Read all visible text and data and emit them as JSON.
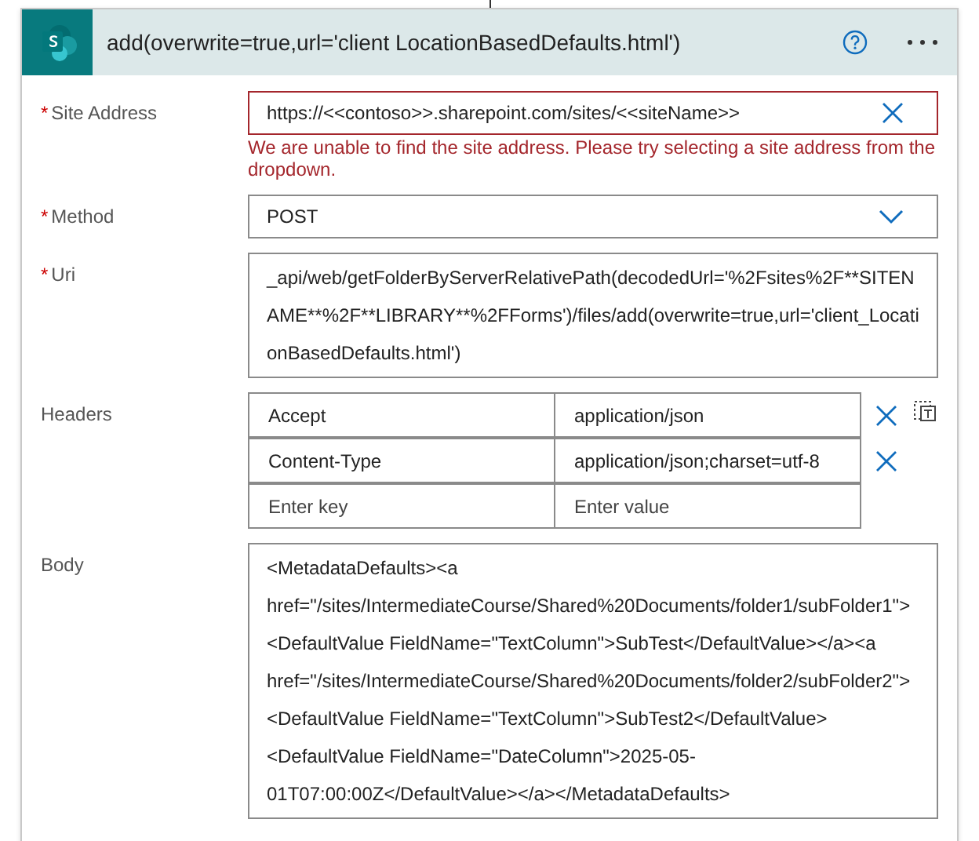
{
  "card": {
    "title": "add(overwrite=true,url='client LocationBasedDefaults.html')",
    "fields": [
      {
        "kind": "text",
        "label": "Site Address",
        "marker": "*",
        "value": "https://<<contoso>>.sharepoint.com/sites/<<siteName>>",
        "error": "We are unable to find the site address. Please try selecting a site address from the dropdown."
      },
      {
        "kind": "dropdown",
        "label": "Method",
        "marker": "*",
        "value": "POST"
      },
      {
        "kind": "multiline",
        "label": "Uri",
        "marker": "*",
        "value": "_api/web/getFolderByServerRelativePath(decodedUrl='%2Fsites%2F**SITENAME**%2F**LIBRARY**%2FForms')/files/add(overwrite=true,url='client_LocationBasedDefaults.html')"
      },
      {
        "kind": "headers",
        "label": "Headers",
        "rows": [
          {
            "key": "Accept",
            "value": "application/json"
          },
          {
            "key": "Content-Type",
            "value": "application/json;charset=utf-8"
          }
        ],
        "key_placeholder": "Enter key",
        "value_placeholder": "Enter value"
      },
      {
        "kind": "multiline",
        "label": "Body",
        "value": "<MetadataDefaults><a href=\"/sites/IntermediateCourse/Shared%20Documents/folder1/subFolder1\"><DefaultValue FieldName=\"TextColumn\">SubTest</DefaultValue></a><a href=\"/sites/IntermediateCourse/Shared%20Documents/folder2/subFolder2\"><DefaultValue FieldName=\"TextColumn\">SubTest2</DefaultValue><DefaultValue FieldName=\"DateColumn\">2025-05-01T07:00:00Z</DefaultValue></a></MetadataDefaults>"
      }
    ]
  }
}
